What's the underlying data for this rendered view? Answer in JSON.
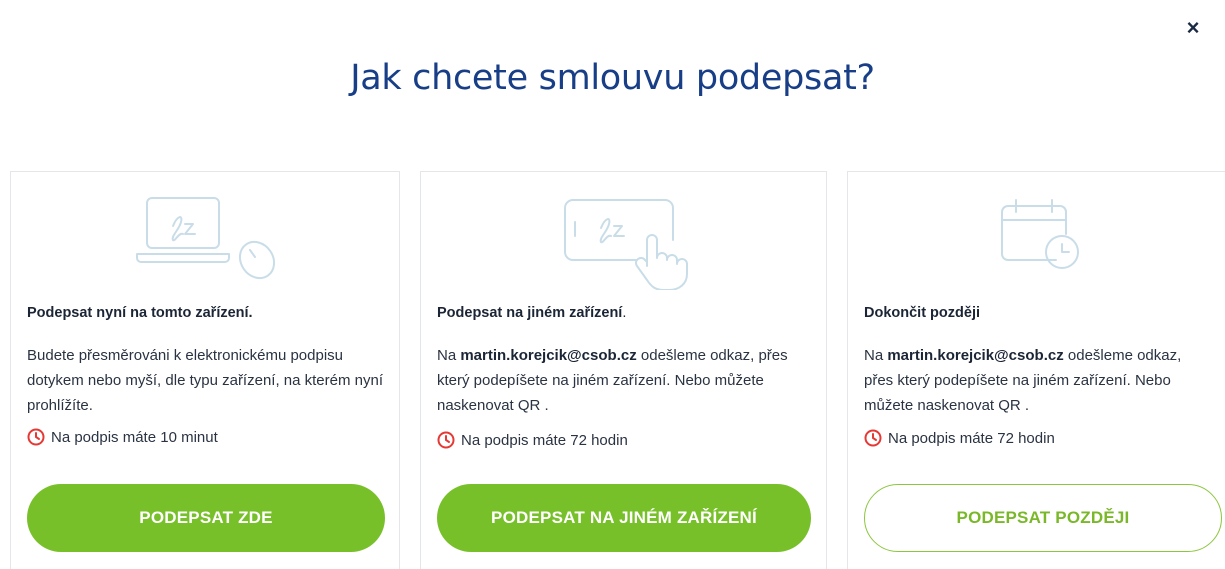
{
  "dialog": {
    "title": "Jak chcete smlouvu podepsat?",
    "close_symbol": "×"
  },
  "colors": {
    "title": "#173e86",
    "primary_green": "#78c02a",
    "timer_red": "#e53935",
    "icon_line": "#c9dde8"
  },
  "cards": [
    {
      "icon": "laptop-mouse-signature-icon",
      "heading": "Podepsat nyní na tomto zařízení.",
      "description": "Budete přesměrováni k elektronickému podpisu dotykem nebo myší, dle typu zařízení, na kterém nyní prohlížíte.",
      "timer": "Na podpis máte 10 minut",
      "button": "PODEPSAT ZDE"
    },
    {
      "icon": "tablet-touch-signature-icon",
      "heading": "Podepsat na jiném zařízení",
      "heading_suffix": ".",
      "description_prefix": "Na ",
      "email": "martin.korejcik@csob.cz",
      "description_suffix": " odešleme odkaz, přes který podepíšete na jiném zařízení. Nebo můžete naskenovat QR .",
      "timer": "Na podpis máte 72 hodin",
      "button": "PODEPSAT NA JINÉM ZAŘÍZENÍ"
    },
    {
      "icon": "calendar-clock-icon",
      "heading": "Dokončit později",
      "description_prefix": "Na ",
      "email": "martin.korejcik@csob.cz",
      "description_suffix": " odešleme odkaz, přes který podepíšete na jiném zařízení. Nebo můžete naskenovat QR .",
      "timer": "Na podpis máte 72 hodin",
      "button": "PODEPSAT POZDĚJI"
    }
  ]
}
